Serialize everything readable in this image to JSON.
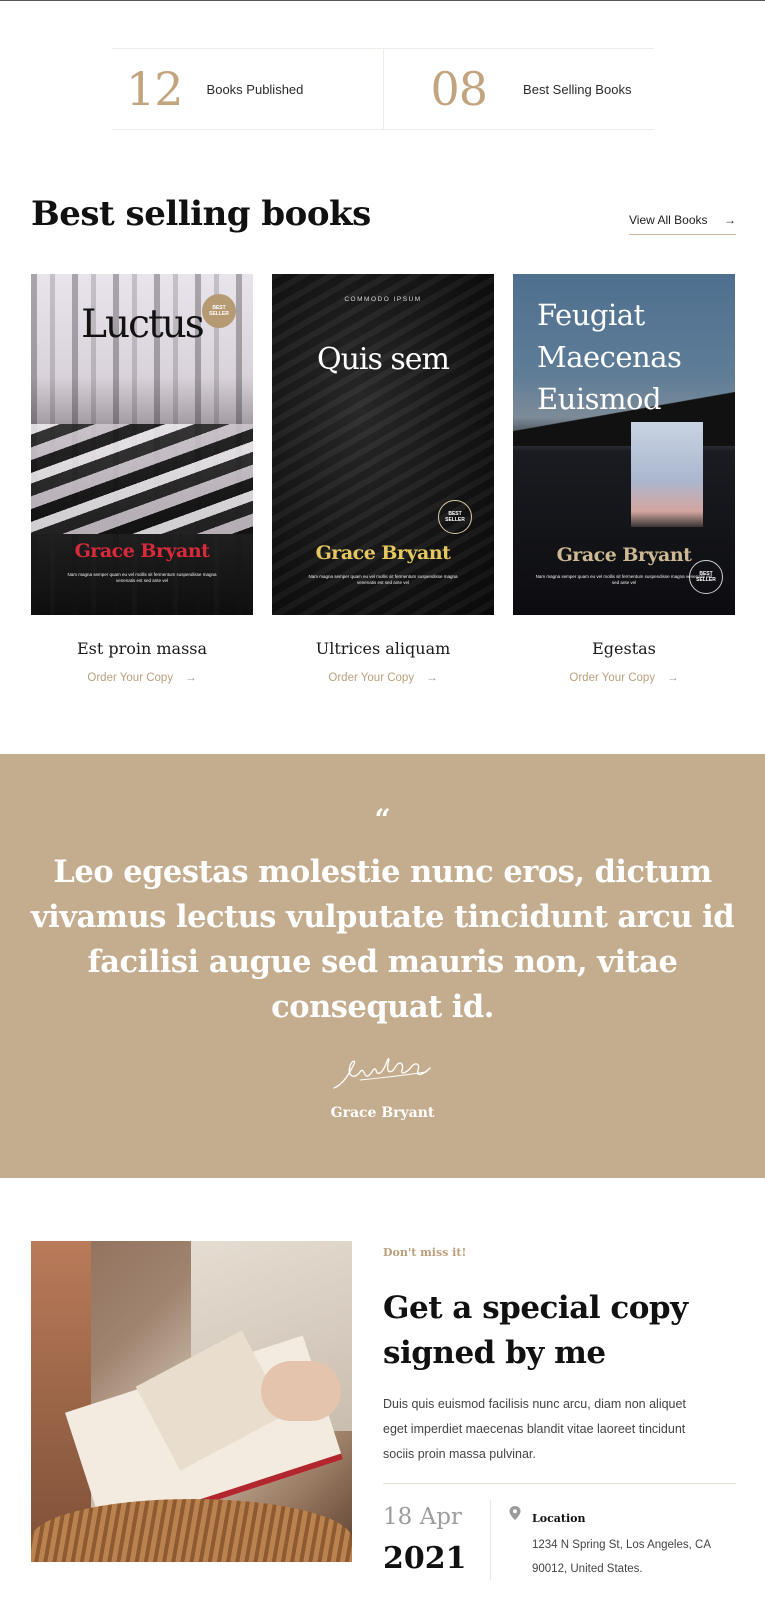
{
  "stats": [
    {
      "number": "12",
      "label": "Books Published"
    },
    {
      "number": "08",
      "label": "Best Selling Books"
    }
  ],
  "best_selling": {
    "title": "Best selling books",
    "view_all": "View All Books",
    "arrow": "→",
    "books": [
      {
        "cover_title": "Luctus",
        "cover_author": "Grace Bryant",
        "cover_blurb": "Nam magna semper quam eu vel mollis sit fermentum suspendisse magna venenatis est sed ante vel",
        "badge": "BEST SELLER",
        "title": "Est proin massa",
        "order": "Order Your Copy"
      },
      {
        "cover_tag": "COMMODO IPSUM",
        "cover_title": "Quis sem",
        "cover_author": "Grace Bryant",
        "cover_blurb": "Nam magna semper quam eu vel mollis sit fermentum suspendisse magna venenatis est sed ante vel",
        "badge": "BEST SELLER",
        "title": "Ultrices aliquam",
        "order": "Order Your Copy"
      },
      {
        "cover_title_lines": [
          "Feugiat",
          "Maecenas",
          "Euismod"
        ],
        "cover_author": "Grace Bryant",
        "cover_blurb": "Nam magna semper quam eu vel mollis sit fermentum suspendisse magna venenatis est sed ante vel",
        "badge": "BEST SELLER",
        "title": "Egestas",
        "order": "Order Your Copy"
      }
    ]
  },
  "quote": {
    "mark": "“",
    "text": "Leo egestas molestie nunc eros, dictum vivamus lectus vulputate tincidunt arcu id facilisi augue sed mauris non, vitae consequat id.",
    "author": "Grace Bryant"
  },
  "signed": {
    "kicker": "Don't miss it!",
    "title": "Get a special copy signed by me",
    "description": "Duis quis euismod facilisis nunc arcu, diam non aliquet eget imperdiet maecenas blandit vitae laoreet tincidunt sociis proin massa pulvinar.",
    "date_day": "18 Apr",
    "date_year": "2021",
    "location_label": "Location",
    "location_address": "1234 N Spring St, Los Angeles, CA 90012, United States."
  },
  "colors": {
    "accent": "#c2a47e",
    "quote_band": "#c4ad8f"
  }
}
